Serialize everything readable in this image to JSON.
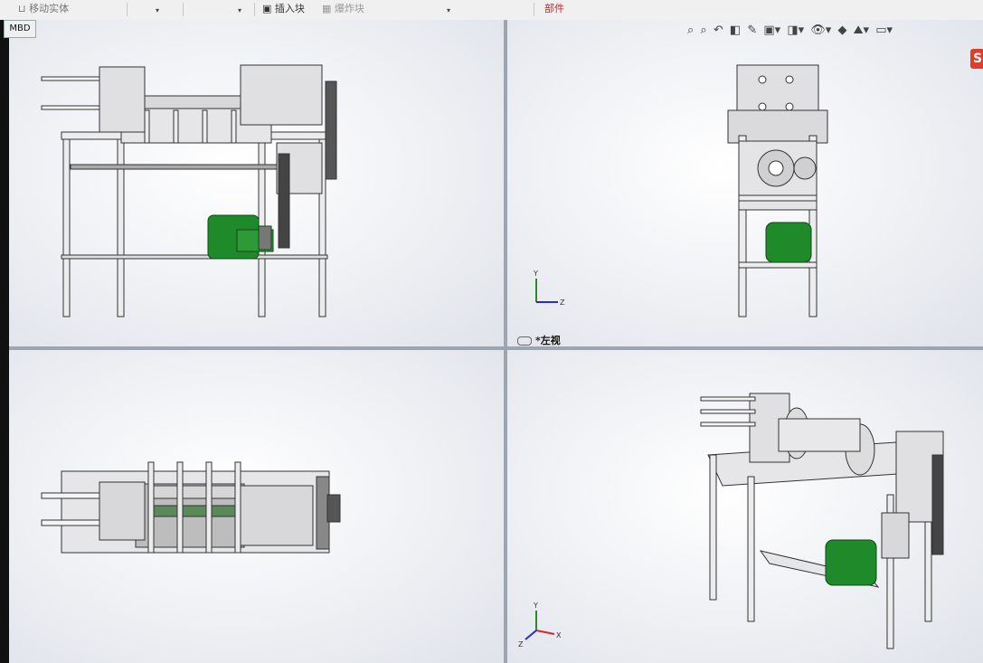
{
  "toolbar": {
    "move_entity": "移动实体",
    "insert_block": "插入块",
    "make_block": "爆炸块",
    "component": "部件"
  },
  "tabs": {
    "mbd": "MBD"
  },
  "view_toolbar": {
    "icons": [
      "zoom-to-fit-icon",
      "zoom-to-area-icon",
      "previous-view-icon",
      "section-view-icon",
      "dynamic-annotation-icon",
      "view-orientation-icon",
      "display-style-icon",
      "hide-show-icon",
      "edit-appearance-icon",
      "apply-scene-icon",
      "view-settings-icon"
    ]
  },
  "viewports": {
    "left_view_label": "*左视"
  },
  "triad": {
    "x": "X",
    "y": "Y",
    "z": "Z"
  },
  "colors": {
    "motor": "#1f8a2a",
    "frame": "#e8e8ea",
    "divider": "#9da6b0"
  }
}
